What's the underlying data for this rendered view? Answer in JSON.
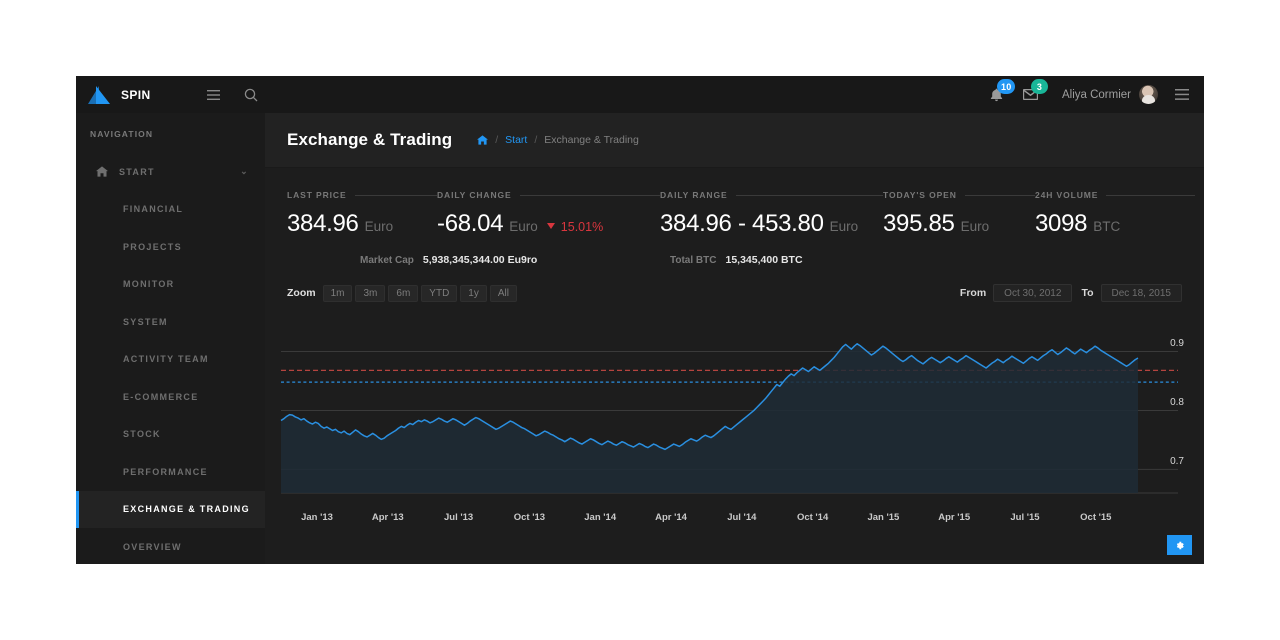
{
  "app": {
    "brand": "SPIN",
    "logo_color": "#2196f3",
    "accent": "#2196f3"
  },
  "topbar": {
    "menu_icon": "hamburger-icon",
    "search_icon": "search-icon",
    "notifications": {
      "icon": "bell-icon",
      "count": "10",
      "color": "#2196f3"
    },
    "messages": {
      "icon": "envelope-icon",
      "count": "3",
      "color": "#19b698"
    },
    "username": "Aliya Cormier",
    "avatar": "user-avatar",
    "right_menu_icon": "list-icon"
  },
  "sidebar": {
    "heading": "NAVIGATION",
    "root": {
      "label": "START",
      "icon": "home-icon",
      "chevron": "⌄"
    },
    "items": [
      {
        "label": "FINANCIAL",
        "active": false
      },
      {
        "label": "PROJECTS",
        "active": false
      },
      {
        "label": "MONITOR",
        "active": false
      },
      {
        "label": "SYSTEM",
        "active": false
      },
      {
        "label": "ACTIVITY TEAM",
        "active": false
      },
      {
        "label": "E-COMMERCE",
        "active": false
      },
      {
        "label": "STOCK",
        "active": false
      },
      {
        "label": "PERFORMANCE",
        "active": false
      },
      {
        "label": "EXCHANGE & TRADING",
        "active": true
      },
      {
        "label": "OVERVIEW",
        "active": false
      }
    ]
  },
  "page": {
    "title": "Exchange & Trading",
    "breadcrumb": {
      "home_icon": "home-icon",
      "sep": "/",
      "link": "Start",
      "current": "Exchange & Trading"
    }
  },
  "stats": [
    {
      "label": "LAST PRICE",
      "value": "384.96",
      "unit": "Euro"
    },
    {
      "label": "DAILY CHANGE",
      "value": "-68.04",
      "unit": "Euro",
      "change_pct": "15.01%",
      "change_dir": "down",
      "change_color": "#d9363e"
    },
    {
      "label": "DAILY RANGE",
      "value": "384.96 - 453.80",
      "unit": "Euro"
    },
    {
      "label": "TODAY'S OPEN",
      "value": "395.85",
      "unit": "Euro"
    },
    {
      "label": "24H VOLUME",
      "value": "3098",
      "unit": "BTC"
    }
  ],
  "substats": [
    {
      "label": "Market Cap",
      "value": "5,938,345,344.00 Eu9ro"
    },
    {
      "label": "Total BTC",
      "value": "15,345,400 BTC"
    }
  ],
  "chart_tools": {
    "zoom_label": "Zoom",
    "zoom_options": [
      "1m",
      "3m",
      "6m",
      "YTD",
      "1y",
      "All"
    ],
    "from_label": "From",
    "from_value": "Oct 30, 2012",
    "to_label": "To",
    "to_value": "Dec 18, 2015"
  },
  "settings_fab": {
    "icon": "gear-icon",
    "color": "#2196f3"
  },
  "chart_data": {
    "type": "line",
    "title": "",
    "xlabel": "",
    "ylabel": "",
    "grid": true,
    "legend": "none",
    "line_color": "#2a8fe0",
    "area_fill": "#1e2b36",
    "ylim": [
      0.66,
      0.95
    ],
    "yticks": [
      0.7,
      0.8,
      0.9
    ],
    "ytick_labels": [
      "0.7",
      "0.8",
      "0.9"
    ],
    "xtick_labels": [
      "Jan '13",
      "Apr '13",
      "Jul '13",
      "Oct '13",
      "Jan '14",
      "Apr '14",
      "Jul '14",
      "Oct '14",
      "Jan '15",
      "Apr '15",
      "Jul '15",
      "Oct '15"
    ],
    "reference_lines": [
      {
        "value": 0.868,
        "color": "#b5443f",
        "style": "dashed"
      },
      {
        "value": 0.848,
        "color": "#2a8fe0",
        "style": "dotted"
      }
    ],
    "x_start": "Oct 30, 2012",
    "x_end": "Dec 18, 2015",
    "values": [
      0.783,
      0.786,
      0.79,
      0.793,
      0.792,
      0.789,
      0.787,
      0.784,
      0.786,
      0.782,
      0.779,
      0.777,
      0.78,
      0.778,
      0.773,
      0.77,
      0.772,
      0.769,
      0.766,
      0.768,
      0.764,
      0.762,
      0.765,
      0.761,
      0.759,
      0.763,
      0.767,
      0.764,
      0.76,
      0.757,
      0.755,
      0.758,
      0.761,
      0.758,
      0.754,
      0.751,
      0.753,
      0.757,
      0.76,
      0.763,
      0.766,
      0.77,
      0.773,
      0.771,
      0.775,
      0.778,
      0.776,
      0.78,
      0.783,
      0.781,
      0.784,
      0.782,
      0.779,
      0.781,
      0.784,
      0.787,
      0.785,
      0.782,
      0.78,
      0.783,
      0.786,
      0.784,
      0.781,
      0.778,
      0.775,
      0.778,
      0.782,
      0.785,
      0.788,
      0.786,
      0.783,
      0.78,
      0.777,
      0.774,
      0.771,
      0.768,
      0.77,
      0.773,
      0.776,
      0.779,
      0.782,
      0.78,
      0.777,
      0.774,
      0.771,
      0.769,
      0.766,
      0.763,
      0.76,
      0.757,
      0.759,
      0.762,
      0.765,
      0.763,
      0.76,
      0.758,
      0.755,
      0.752,
      0.75,
      0.747,
      0.75,
      0.753,
      0.751,
      0.748,
      0.745,
      0.743,
      0.746,
      0.749,
      0.752,
      0.75,
      0.747,
      0.744,
      0.742,
      0.745,
      0.748,
      0.746,
      0.743,
      0.741,
      0.744,
      0.747,
      0.745,
      0.742,
      0.74,
      0.738,
      0.741,
      0.744,
      0.742,
      0.739,
      0.737,
      0.74,
      0.743,
      0.741,
      0.738,
      0.736,
      0.734,
      0.737,
      0.74,
      0.743,
      0.741,
      0.739,
      0.742,
      0.746,
      0.749,
      0.752,
      0.75,
      0.748,
      0.751,
      0.755,
      0.758,
      0.756,
      0.754,
      0.757,
      0.761,
      0.765,
      0.769,
      0.773,
      0.77,
      0.768,
      0.772,
      0.776,
      0.78,
      0.784,
      0.788,
      0.792,
      0.796,
      0.8,
      0.805,
      0.81,
      0.815,
      0.82,
      0.826,
      0.832,
      0.838,
      0.844,
      0.841,
      0.847,
      0.853,
      0.858,
      0.862,
      0.859,
      0.864,
      0.868,
      0.872,
      0.869,
      0.866,
      0.87,
      0.874,
      0.871,
      0.868,
      0.872,
      0.876,
      0.88,
      0.885,
      0.89,
      0.896,
      0.902,
      0.908,
      0.912,
      0.908,
      0.904,
      0.909,
      0.913,
      0.91,
      0.906,
      0.902,
      0.898,
      0.894,
      0.897,
      0.901,
      0.905,
      0.909,
      0.906,
      0.902,
      0.898,
      0.894,
      0.89,
      0.886,
      0.883,
      0.886,
      0.89,
      0.893,
      0.889,
      0.885,
      0.882,
      0.879,
      0.883,
      0.887,
      0.89,
      0.887,
      0.884,
      0.881,
      0.884,
      0.888,
      0.891,
      0.888,
      0.885,
      0.882,
      0.886,
      0.889,
      0.893,
      0.89,
      0.887,
      0.884,
      0.881,
      0.878,
      0.875,
      0.872,
      0.876,
      0.88,
      0.883,
      0.887,
      0.884,
      0.881,
      0.885,
      0.888,
      0.892,
      0.889,
      0.886,
      0.883,
      0.88,
      0.884,
      0.888,
      0.891,
      0.888,
      0.885,
      0.889,
      0.893,
      0.896,
      0.9,
      0.903,
      0.899,
      0.895,
      0.898,
      0.902,
      0.906,
      0.903,
      0.899,
      0.896,
      0.9,
      0.904,
      0.901,
      0.898,
      0.902,
      0.905,
      0.909,
      0.906,
      0.902,
      0.899,
      0.896,
      0.893,
      0.89,
      0.887,
      0.884,
      0.881,
      0.878,
      0.875,
      0.878,
      0.882,
      0.886,
      0.889
    ]
  }
}
